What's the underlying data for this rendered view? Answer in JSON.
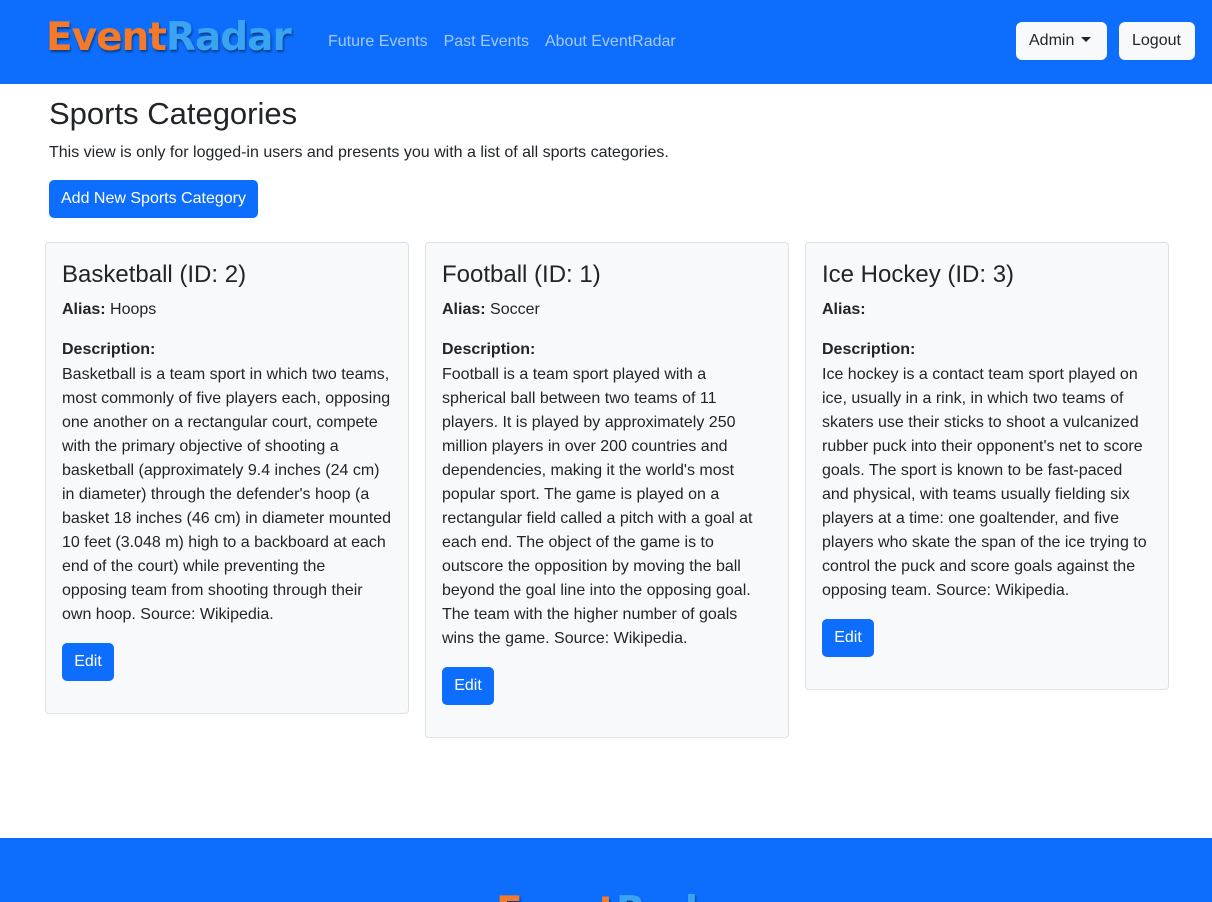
{
  "brand": {
    "part1": "Event",
    "part2": "Radar"
  },
  "nav": {
    "links": [
      "Future Events",
      "Past Events",
      "About EventRadar"
    ],
    "admin_label": "Admin",
    "logout_label": "Logout"
  },
  "page": {
    "title": "Sports Categories",
    "lead": "This view is only for logged-in users and presents you with a list of all sports categories.",
    "add_button": "Add New Sports Category"
  },
  "labels": {
    "alias": "Alias:",
    "description": "Description:",
    "edit": "Edit"
  },
  "categories": [
    {
      "title": "Basketball (ID: 2)",
      "alias": "Hoops",
      "description": "Basketball is a team sport in which two teams, most commonly of five players each, opposing one another on a rectangular court, compete with the primary objective of shooting a basketball (approximately 9.4 inches (24 cm) in diameter) through the defender's hoop (a basket 18 inches (46 cm) in diameter mounted 10 feet (3.048 m) high to a backboard at each end of the court) while preventing the opposing team from shooting through their own hoop. Source: Wikipedia."
    },
    {
      "title": "Football (ID: 1)",
      "alias": "Soccer",
      "description": "Football is a team sport played with a spherical ball between two teams of 11 players. It is played by approximately 250 million players in over 200 countries and dependencies, making it the world's most popular sport. The game is played on a rectangular field called a pitch with a goal at each end. The object of the game is to outscore the opposition by moving the ball beyond the goal line into the opposing goal. The team with the higher number of goals wins the game. Source: Wikipedia."
    },
    {
      "title": "Ice Hockey (ID: 3)",
      "alias": "",
      "description": "Ice hockey is a contact team sport played on ice, usually in a rink, in which two teams of skaters use their sticks to shoot a vulcanized rubber puck into their opponent's net to score goals. The sport is known to be fast-paced and physical, with teams usually fielding six players at a time: one goaltender, and five players who skate the span of the ice trying to control the puck and score goals against the opposing team. Source: Wikipedia."
    }
  ],
  "colors": {
    "primary": "#0d6efd",
    "card_bg": "#f8f9fa",
    "logo_orange": "#f47a2a",
    "logo_blue": "#3aa3f2"
  }
}
